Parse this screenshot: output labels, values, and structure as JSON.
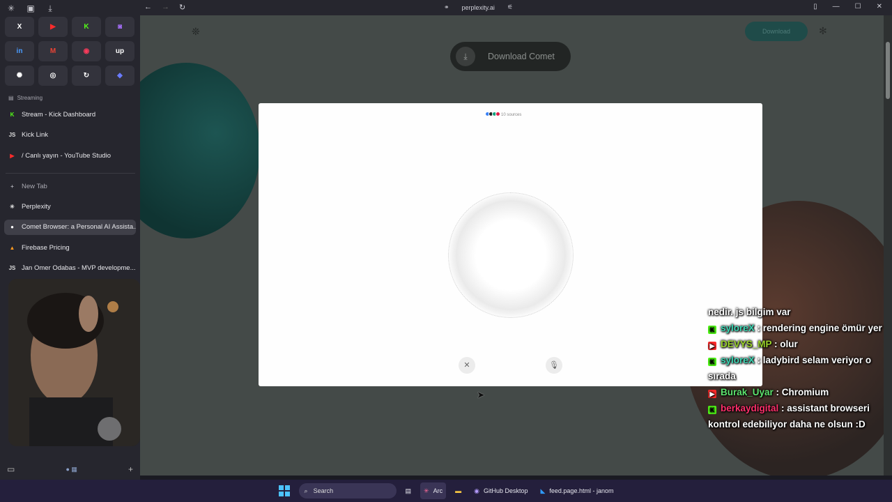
{
  "topbar": {
    "url": "perplexity.ai"
  },
  "sidebar": {
    "pins": [
      {
        "icon": "x-icon",
        "glyph": "X",
        "color": "#ffffff"
      },
      {
        "icon": "youtube-icon",
        "glyph": "▶",
        "color": "#ff2b2b"
      },
      {
        "icon": "kick-icon",
        "glyph": "K",
        "color": "#53fc18"
      },
      {
        "icon": "twitch-icon",
        "glyph": "◙",
        "color": "#a970ff"
      },
      {
        "icon": "linkedin-icon",
        "glyph": "in",
        "color": "#4a9cff"
      },
      {
        "icon": "gmail-icon",
        "glyph": "M",
        "color": "#ea4335"
      },
      {
        "icon": "record-icon",
        "glyph": "◉",
        "color": "#ff3b5c"
      },
      {
        "icon": "upwork-icon",
        "glyph": "up",
        "color": "#ffffff"
      },
      {
        "icon": "chatgpt-icon",
        "glyph": "✺",
        "color": "#ffffff"
      },
      {
        "icon": "target-icon",
        "glyph": "◎",
        "color": "#ffffff"
      },
      {
        "icon": "sync-icon",
        "glyph": "↻",
        "color": "#ffffff"
      },
      {
        "icon": "diamond-icon",
        "glyph": "◆",
        "color": "#6a7bff"
      }
    ],
    "section": "Streaming",
    "streaming_tabs": [
      {
        "label": "Stream - Kick Dashboard",
        "icon": "kick-icon",
        "color": "#53fc18",
        "glyph": "K"
      },
      {
        "label": "Kick Link",
        "icon": "link-icon",
        "color": "#dddddd",
        "glyph": "JS"
      },
      {
        "label": "/ Canlı yayın - YouTube Studio",
        "icon": "youtube-icon",
        "color": "#ff2b2b",
        "glyph": "▶"
      }
    ],
    "new_tab": "New Tab",
    "tabs": [
      {
        "label": "Perplexity",
        "icon": "perplexity-icon",
        "color": "#dddddd",
        "glyph": "✳"
      },
      {
        "label": "Comet Browser: a Personal AI Assista...",
        "icon": "comet-icon",
        "color": "#ffffff",
        "glyph": "●"
      },
      {
        "label": "Firebase Pricing",
        "icon": "firebase-icon",
        "color": "#ff9a1f",
        "glyph": "▲"
      },
      {
        "label": "Jan Omer Odabas - MVP developme...",
        "icon": "site-icon",
        "color": "#dddddd",
        "glyph": "JS"
      }
    ]
  },
  "page": {
    "download_comet": "Download Comet",
    "download_top": "Download"
  },
  "modal": {
    "sources_text": "10 sources",
    "source_colors": [
      "#3b82f6",
      "#222222",
      "#10a37f",
      "#e11d48"
    ]
  },
  "chat": [
    {
      "platform": "",
      "user": "",
      "user_color": "#ffffff",
      "message": "nedir. js bilgim var"
    },
    {
      "platform": "kick",
      "user": "syloreX",
      "user_color": "#3cd6b3",
      "message": " : rendering engine ömür yer"
    },
    {
      "platform": "youtube",
      "user": "DEVYS_MP",
      "user_color": "#9bd42a",
      "message": " : olur"
    },
    {
      "platform": "kick",
      "user": "syloreX",
      "user_color": "#3cd6b3",
      "message": " : ladybird selam veriyor o sırada"
    },
    {
      "platform": "youtube",
      "user": "Burak_Uyar",
      "user_color": "#5de36e",
      "message": " : Chromium"
    },
    {
      "platform": "kick",
      "user": "berkaydigital",
      "user_color": "#ff2f6b",
      "message": " : assistant browseri kontrol edebiliyor daha ne olsun :D"
    }
  ],
  "taskbar": {
    "search": "Search",
    "items": [
      "Arc",
      "GitHub Desktop",
      "feed.page.html - janom"
    ]
  }
}
